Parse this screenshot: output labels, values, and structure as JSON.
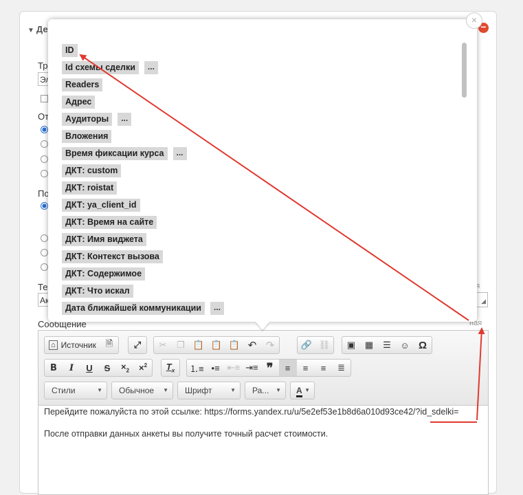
{
  "background_form": {
    "section_title_prefix": "Де",
    "labels": {
      "tr": "Тр",
      "el": "Эл",
      "ot": "От",
      "po": "По",
      "te": "Те",
      "ak": "Ак",
      "message": "Сообщение"
    },
    "side_labels": {
      "right_1": "ная",
      "right_2": "ная"
    }
  },
  "popup": {
    "close_icon": "close-icon",
    "fields": [
      {
        "label": "ID",
        "more": ""
      },
      {
        "label": "Id схемы сделки",
        "more": "..."
      },
      {
        "label": "Readers",
        "more": ""
      },
      {
        "label": "Адрес",
        "more": ""
      },
      {
        "label": "Аудиторы",
        "more": "..."
      },
      {
        "label": "Вложения",
        "more": ""
      },
      {
        "label": "Время фиксации курса",
        "more": "..."
      },
      {
        "label": "ДКТ: custom",
        "more": ""
      },
      {
        "label": "ДКТ: roistat",
        "more": ""
      },
      {
        "label": "ДКТ: ya_client_id",
        "more": ""
      },
      {
        "label": "ДКТ: Время на сайте",
        "more": ""
      },
      {
        "label": "ДКТ: Имя виджета",
        "more": ""
      },
      {
        "label": "ДКТ: Контекст вызова",
        "more": ""
      },
      {
        "label": "ДКТ: Содержимое",
        "more": ""
      },
      {
        "label": "ДКТ: Что искал",
        "more": ""
      },
      {
        "label": "Дата ближайшей коммуникации",
        "more": "..."
      }
    ]
  },
  "editor": {
    "toolbar": {
      "source_label": "Источник",
      "combos": {
        "styles": "Стили",
        "format": "Обычное",
        "font": "Шрифт",
        "size": "Ра..."
      }
    },
    "content": {
      "line1": "Перейдите пожалуйста по этой ссылке: https://forms.yandex.ru/u/5e2ef53e1b8d6a010d93ce42/?id_sdelki=",
      "line2": "После отправки данных анкеты вы получите точный расчет стоимости."
    }
  },
  "colors": {
    "annotation_red": "#e0392f",
    "tag_bg": "#d8d8d8"
  }
}
